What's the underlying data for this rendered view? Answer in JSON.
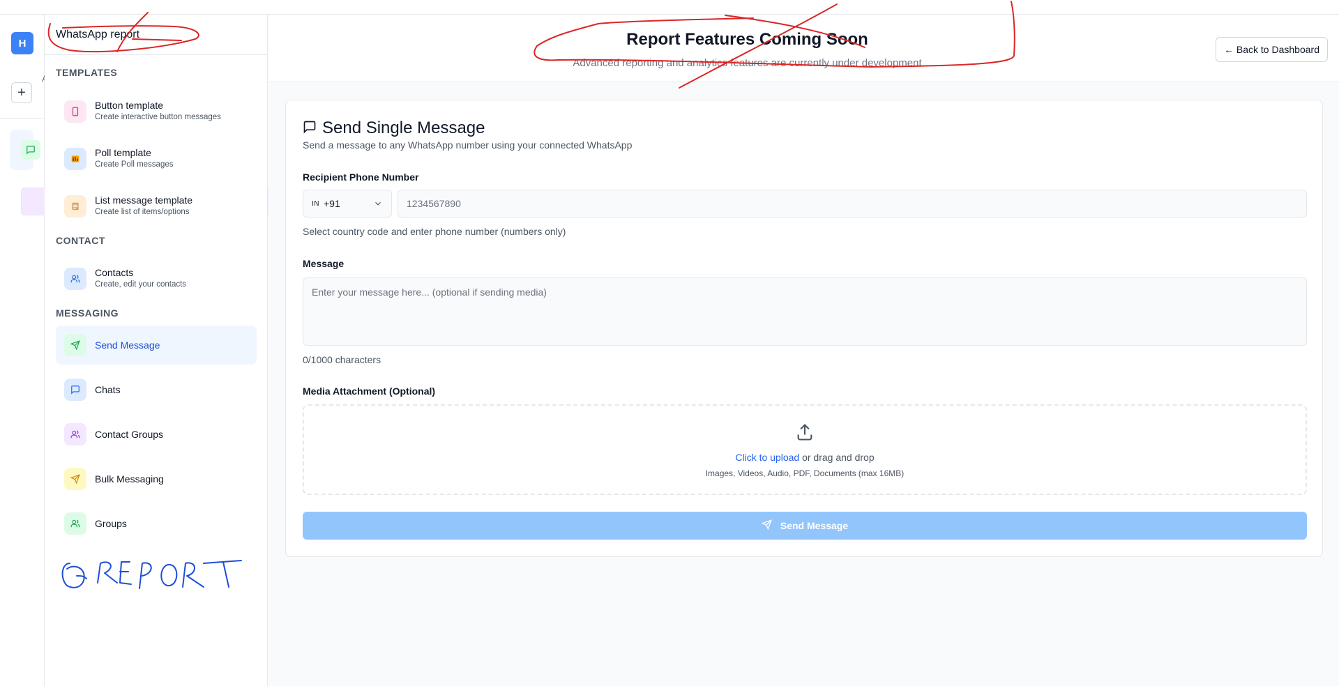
{
  "rail": {
    "avatar_letter": "H",
    "add_symbol": "+",
    "add_tail": "A"
  },
  "sidebar": {
    "title": "WhatsApp report",
    "sections": {
      "templates": "TEMPLATES",
      "contact": "CONTACT",
      "messaging": "MESSAGING"
    },
    "items": [
      {
        "title": "Button template",
        "desc": "Create interactive button messages",
        "icon": "phone-icon"
      },
      {
        "title": "Poll template",
        "desc": "Create Poll messages",
        "icon": "poll-icon"
      },
      {
        "title": "List message template",
        "desc": "Create list of items/options",
        "icon": "list-icon"
      },
      {
        "title": "Contacts",
        "desc": "Create, edit your contacts",
        "icon": "users-icon"
      },
      {
        "title": "Send Message",
        "desc": "",
        "icon": "send-icon",
        "active": true
      },
      {
        "title": "Chats",
        "desc": "",
        "icon": "chat-icon"
      },
      {
        "title": "Contact Groups",
        "desc": "",
        "icon": "users-icon"
      },
      {
        "title": "Bulk Messaging",
        "desc": "",
        "icon": "send-icon"
      },
      {
        "title": "Groups",
        "desc": "",
        "icon": "users-icon"
      }
    ]
  },
  "header": {
    "title": "Report Features Coming Soon",
    "subtitle": "Advanced reporting and analytics features are currently under development",
    "back_button": "← Back to Dashboard"
  },
  "form": {
    "title": "Send Single Message",
    "subtitle": "Send a message to any WhatsApp number using your connected WhatsApp",
    "phone_label": "Recipient Phone Number",
    "country_flag": "IN",
    "country_code": "+91",
    "phone_placeholder": "1234567890",
    "phone_help": "Select country code and enter phone number (numbers only)",
    "message_label": "Message",
    "message_placeholder": "Enter your message here... (optional if sending media)",
    "char_count": "0/1000 characters",
    "media_label": "Media Attachment (Optional)",
    "upload_link": "Click to upload",
    "upload_rest": " or drag and drop",
    "upload_types": "Images, Videos, Audio, PDF, Documents (max 16MB)",
    "send_button": "Send Message"
  },
  "annotations": {
    "handwritten_text": "REPORT",
    "red_color": "#dc2626",
    "blue_color": "#1d4ed8"
  }
}
